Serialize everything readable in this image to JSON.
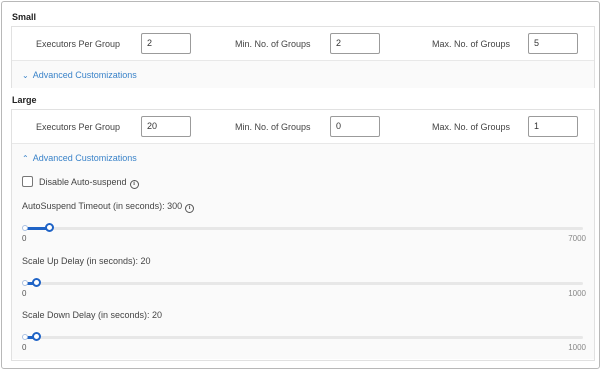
{
  "small": {
    "title": "Small",
    "executors_label": "Executors Per Group",
    "executors_value": "2",
    "min_groups_label": "Min. No. of Groups",
    "min_groups_value": "2",
    "max_groups_label": "Max. No. of Groups",
    "max_groups_value": "5",
    "advanced_label": "Advanced Customizations",
    "advanced_expanded": false
  },
  "large": {
    "title": "Large",
    "executors_label": "Executors Per Group",
    "executors_value": "20",
    "min_groups_label": "Min. No. of Groups",
    "min_groups_value": "0",
    "max_groups_label": "Max. No. of Groups",
    "max_groups_value": "1",
    "advanced_label": "Advanced Customizations",
    "advanced_expanded": true,
    "disable_autosuspend_label": "Disable Auto-suspend",
    "disable_autosuspend_checked": false,
    "sliders": [
      {
        "label": "AutoSuspend Timeout (in seconds): 300",
        "has_info": true,
        "min": "0",
        "max": "7000",
        "value": 300,
        "range_max": 7000
      },
      {
        "label": "Scale Up Delay (in seconds): 20",
        "has_info": false,
        "min": "0",
        "max": "1000",
        "value": 20,
        "range_max": 1000
      },
      {
        "label": "Scale Down Delay (in seconds): 20",
        "has_info": false,
        "min": "0",
        "max": "1000",
        "value": 20,
        "range_max": 1000
      }
    ]
  },
  "icons": {
    "chevron_down": "chevron-down-icon",
    "chevron_up": "chevron-up-icon",
    "info": "info-icon"
  },
  "colors": {
    "accent": "#1f63c6",
    "link": "#3a83c9"
  }
}
